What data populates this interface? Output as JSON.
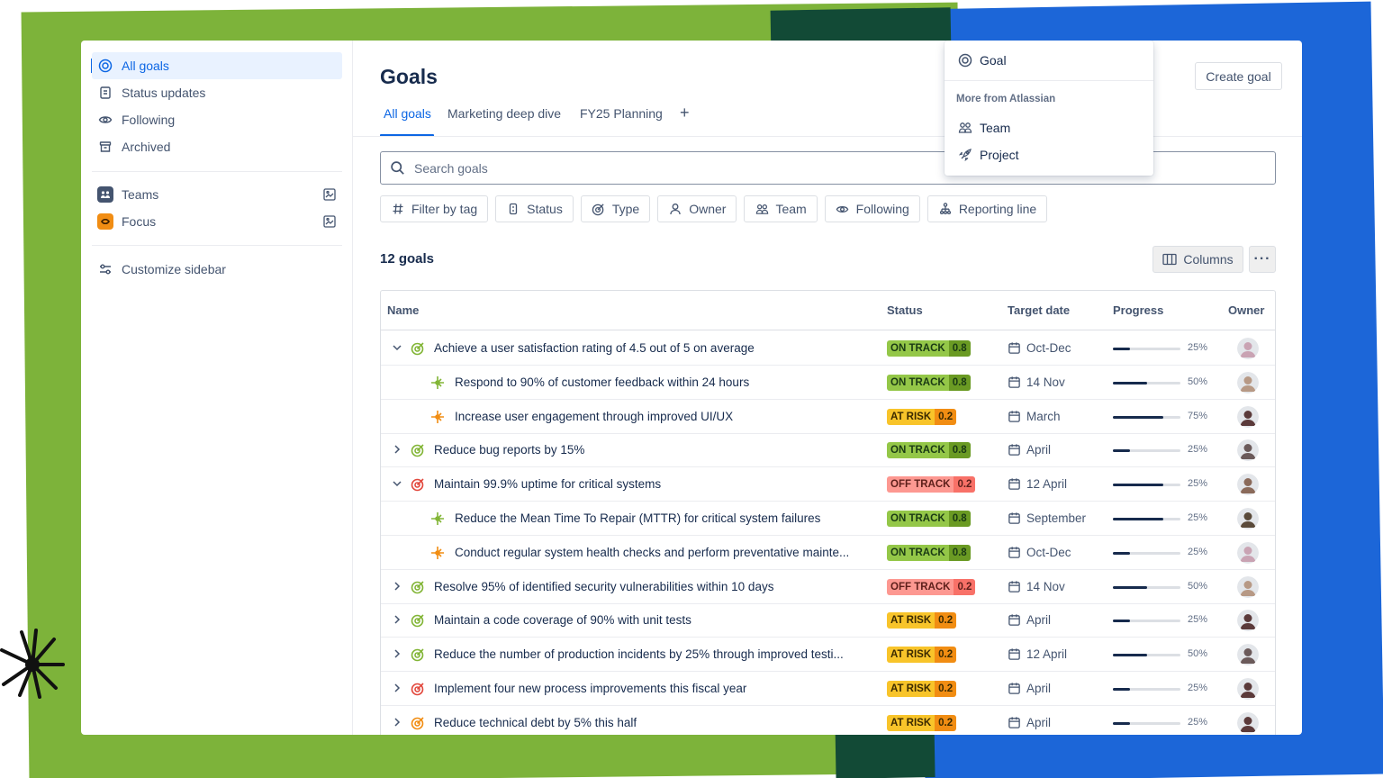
{
  "sidebar": {
    "items": [
      {
        "label": "All goals",
        "icon": "goal-icon",
        "active": true
      },
      {
        "label": "Status updates",
        "icon": "status-updates-icon"
      },
      {
        "label": "Following",
        "icon": "eye-icon"
      },
      {
        "label": "Archived",
        "icon": "archive-icon"
      }
    ],
    "apps": [
      {
        "label": "Teams",
        "icon": "teams-app-icon"
      },
      {
        "label": "Focus",
        "icon": "focus-app-icon"
      }
    ],
    "customize_label": "Customize sidebar"
  },
  "page": {
    "title": "Goals",
    "tabs": [
      "All goals",
      "Marketing deep dive",
      "FY25 Planning"
    ],
    "active_tab": "All goals",
    "create_label": "Create goal"
  },
  "search": {
    "placeholder": "Search goals"
  },
  "filters": [
    {
      "label": "Filter by tag",
      "icon": "hash-icon"
    },
    {
      "label": "Status",
      "icon": "status-icon"
    },
    {
      "label": "Type",
      "icon": "goal-type-icon"
    },
    {
      "label": "Owner",
      "icon": "person-icon"
    },
    {
      "label": "Team",
      "icon": "team-icon"
    },
    {
      "label": "Following",
      "icon": "eye-icon"
    },
    {
      "label": "Reporting line",
      "icon": "hierarchy-icon"
    }
  ],
  "summary": {
    "count_label": "12 goals",
    "columns_label": "Columns",
    "more_label": "···"
  },
  "table": {
    "headers": {
      "name": "Name",
      "status": "Status",
      "target_date": "Target date",
      "progress": "Progress",
      "owner": "Owner"
    },
    "rows": [
      {
        "name": "Achieve a user satisfaction rating of 4.5 out of 5 on average",
        "level": 0,
        "expanded": true,
        "type": "goal",
        "goal_color": "#82b536",
        "status": "ON TRACK",
        "score": "0.8",
        "tone": "on",
        "date": "Oct-Dec",
        "progress": 0.25,
        "pct": "25%",
        "avatar_color": "#c9a3b3"
      },
      {
        "name": "Respond to 90% of customer feedback within 24 hours",
        "level": 1,
        "type": "key-result",
        "kr_color": "#82b536",
        "status": "ON TRACK",
        "score": "0.8",
        "tone": "on",
        "date": "14 Nov",
        "progress": 0.5,
        "pct": "50%",
        "avatar_color": "#b79985"
      },
      {
        "name": "Increase user engagement through improved UI/UX",
        "level": 1,
        "type": "key-result",
        "kr_color": "#f18d13",
        "status": "AT RISK",
        "score": "0.2",
        "tone": "risk",
        "date": "March",
        "progress": 0.75,
        "pct": "75%",
        "avatar_color": "#5b3a3a"
      },
      {
        "name": "Reduce bug reports by 15%",
        "level": 0,
        "expanded": false,
        "type": "goal",
        "goal_color": "#82b536",
        "status": "ON TRACK",
        "score": "0.8",
        "tone": "on",
        "date": "April",
        "progress": 0.25,
        "pct": "25%",
        "avatar_color": "#6b5a5a"
      },
      {
        "name": "Maintain 99.9% uptime for critical systems",
        "level": 0,
        "expanded": true,
        "type": "goal",
        "goal_color": "#e2483d",
        "status": "OFF TRACK",
        "score": "0.2",
        "tone": "off",
        "date": "12 April",
        "progress": 0.75,
        "pct": "25%",
        "avatar_color": "#8a6a5a"
      },
      {
        "name": "Reduce the Mean Time To Repair (MTTR) for critical system failures",
        "level": 1,
        "type": "key-result",
        "kr_color": "#82b536",
        "status": "ON TRACK",
        "score": "0.8",
        "tone": "on",
        "date": "September",
        "progress": 0.75,
        "pct": "25%",
        "avatar_color": "#5a4a3a"
      },
      {
        "name": "Conduct regular system health checks and perform preventative mainte...",
        "level": 1,
        "type": "key-result",
        "kr_color": "#f18d13",
        "status": "ON TRACK",
        "score": "0.8",
        "tone": "on",
        "date": "Oct-Dec",
        "progress": 0.25,
        "pct": "25%",
        "avatar_color": "#c9a3b3"
      },
      {
        "name": "Resolve 95% of identified security vulnerabilities within 10 days",
        "level": 0,
        "expanded": false,
        "type": "goal",
        "goal_color": "#82b536",
        "status": "OFF TRACK",
        "score": "0.2",
        "tone": "off",
        "date": "14 Nov",
        "progress": 0.5,
        "pct": "50%",
        "avatar_color": "#b79985"
      },
      {
        "name": "Maintain a code coverage of 90% with unit tests",
        "level": 0,
        "expanded": false,
        "type": "goal",
        "goal_color": "#82b536",
        "status": "AT RISK",
        "score": "0.2",
        "tone": "risk",
        "date": "April",
        "progress": 0.25,
        "pct": "25%",
        "avatar_color": "#5b3a3a"
      },
      {
        "name": "Reduce the number of production incidents by 25% through improved testi...",
        "level": 0,
        "expanded": false,
        "type": "goal",
        "goal_color": "#82b536",
        "status": "AT RISK",
        "score": "0.2",
        "tone": "risk",
        "date": "12 April",
        "progress": 0.5,
        "pct": "50%",
        "avatar_color": "#6b5a5a"
      },
      {
        "name": "Implement four new process improvements this fiscal year",
        "level": 0,
        "expanded": false,
        "type": "goal",
        "goal_color": "#e2483d",
        "status": "AT RISK",
        "score": "0.2",
        "tone": "risk",
        "date": "April",
        "progress": 0.25,
        "pct": "25%",
        "avatar_color": "#5b3a3a"
      },
      {
        "name": "Reduce technical debt by 5% this half",
        "level": 0,
        "expanded": false,
        "type": "goal",
        "goal_color": "#f18d13",
        "status": "AT RISK",
        "score": "0.2",
        "tone": "risk",
        "date": "April",
        "progress": 0.25,
        "pct": "25%",
        "avatar_color": "#5b3a3a"
      }
    ]
  },
  "dropdown": {
    "primary": {
      "label": "Goal",
      "icon": "goal-icon"
    },
    "section_heading": "More from Atlassian",
    "items": [
      {
        "label": "Team",
        "icon": "team-icon"
      },
      {
        "label": "Project",
        "icon": "rocket-icon"
      }
    ]
  },
  "colors": {
    "accent": "#0c66e4",
    "bg_green": "#7db33a",
    "bg_blue": "#1c66d8",
    "bg_dark_green": "#124a36"
  }
}
